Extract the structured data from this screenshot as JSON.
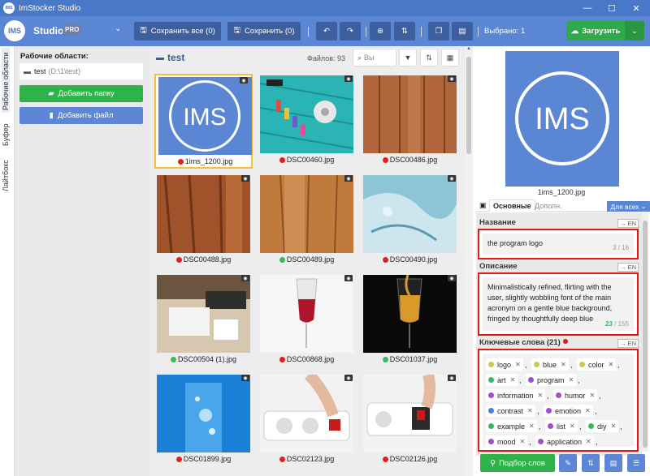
{
  "window": {
    "title": "ImStocker Studio",
    "logo_text": "IMS",
    "controls": [
      "—",
      "☐",
      "✕"
    ]
  },
  "toolbar": {
    "logo_text": "IMS",
    "app_name": "Studio",
    "edition": "PRO",
    "save_all_label": "Сохранить все (0)",
    "save_label": "Сохранить (0)",
    "selected_label": "Выбрано: 1",
    "upload_label": "Загрузить",
    "icons": [
      "undo-icon",
      "redo-icon",
      "binoculars-icon",
      "sliders-icon",
      "copy-icon",
      "paste-icon"
    ]
  },
  "side_tabs": [
    "Рабочие области",
    "Буфер",
    "Лайтбокс"
  ],
  "workspaces": {
    "title": "Рабочие области:",
    "item_name": "test",
    "item_path": "(D:\\1\\test)",
    "add_folder_label": "Добавить папку",
    "add_file_label": "Добавить файл"
  },
  "browser": {
    "folder_name": "test",
    "file_count": "Файлов: 93",
    "search_placeholder": "Вы"
  },
  "files": [
    {
      "name": "1ims_1200.jpg",
      "status": "red",
      "selected": true,
      "thumb": "ims"
    },
    {
      "name": "DSC00460.jpg",
      "status": "red",
      "thumb": "threads"
    },
    {
      "name": "DSC00486.jpg",
      "status": "red",
      "thumb": "wood1"
    },
    {
      "name": "DSC00488.jpg",
      "status": "red",
      "thumb": "wood2"
    },
    {
      "name": "DSC00489.jpg",
      "status": "green",
      "thumb": "wood3"
    },
    {
      "name": "DSC00490.jpg",
      "status": "red",
      "thumb": "ice"
    },
    {
      "name": "DSC00504 (1).jpg",
      "status": "green",
      "thumb": "desk"
    },
    {
      "name": "DSC00868.jpg",
      "status": "red",
      "thumb": "redwine"
    },
    {
      "name": "DSC01037.jpg",
      "status": "green",
      "thumb": "whitewine"
    },
    {
      "name": "DSC01899.jpg",
      "status": "red",
      "thumb": "water"
    },
    {
      "name": "DSC02123.jpg",
      "status": "red",
      "thumb": "socket1"
    },
    {
      "name": "DSC02126.jpg",
      "status": "red",
      "thumb": "socket2"
    }
  ],
  "details": {
    "preview_name": "1ims_1200.jpg",
    "preview_logo": "IMS",
    "tab_main": "Основные",
    "tab_extra": "Дополн.",
    "for_all": "Для всех",
    "lang_tag": "→ EN",
    "title_label": "Название",
    "title_value": "the program logo",
    "title_count": "3 / 16",
    "desc_label": "Описание",
    "desc_value": "Minimalistically refined, flirting with the user, slightly wobbling font of the main acronym on a gentle blue background, fringed by thoughtfully deep blue",
    "desc_count_used": "23",
    "desc_count_total": "/ 155",
    "keywords_label": "Ключевые слова (21)",
    "keywords": [
      {
        "text": "logo",
        "color": "#c9c94f",
        "comma": true
      },
      {
        "text": "blue",
        "color": "#c9c94f",
        "comma": true
      },
      {
        "text": "color",
        "color": "#c9c94f",
        "comma": true
      },
      {
        "text": "art",
        "color": "#3cb65a",
        "comma": true
      },
      {
        "text": "program",
        "color": "#a24fc9",
        "comma": true
      },
      {
        "text": "information",
        "color": "#a24fc9",
        "comma": true
      },
      {
        "text": "humor",
        "color": "#a24fc9",
        "comma": true
      },
      {
        "text": "contrast",
        "color": "#4f7fd6",
        "comma": true
      },
      {
        "text": "emotion",
        "color": "#a24fc9",
        "comma": true
      },
      {
        "text": "example",
        "color": "#3cb65a",
        "comma": true
      },
      {
        "text": "list",
        "color": "#a24fc9",
        "comma": true
      },
      {
        "text": "diy",
        "color": "#3cb65a",
        "comma": true
      },
      {
        "text": "mood",
        "color": "#a24fc9",
        "comma": true
      },
      {
        "text": "application",
        "color": "#a24fc9",
        "comma": true
      }
    ],
    "pick_keywords_label": "Подбор слов"
  },
  "colors": {
    "accent": "#5a86d4",
    "dark": "#3e5f9e",
    "green": "#2fb24a",
    "red": "#e01818"
  }
}
